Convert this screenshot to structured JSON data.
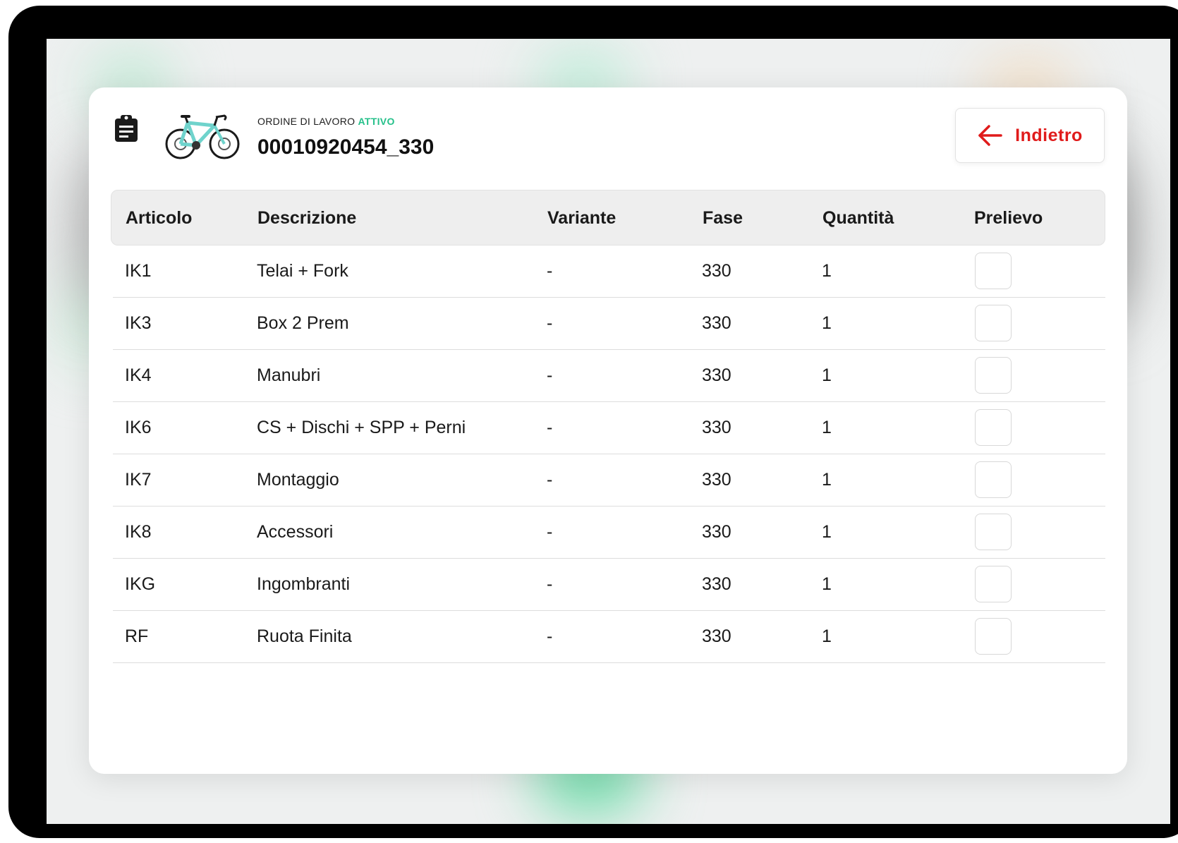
{
  "order": {
    "label": "ORDINE DI LAVORO",
    "status": "ATTIVO",
    "number": "00010920454_330"
  },
  "back_button": {
    "label": "Indietro"
  },
  "table": {
    "headers": [
      "Articolo",
      "Descrizione",
      "Variante",
      "Fase",
      "Quantità",
      "Prelievo"
    ],
    "rows": [
      {
        "articolo": "IK1",
        "descrizione": "Telai + Fork",
        "variante": "-",
        "fase": "330",
        "quantita": "1",
        "prelievo": false
      },
      {
        "articolo": "IK3",
        "descrizione": "Box 2 Prem",
        "variante": "-",
        "fase": "330",
        "quantita": "1",
        "prelievo": false
      },
      {
        "articolo": "IK4",
        "descrizione": "Manubri",
        "variante": "-",
        "fase": "330",
        "quantita": "1",
        "prelievo": false
      },
      {
        "articolo": "IK6",
        "descrizione": "CS + Dischi + SPP + Perni",
        "variante": "-",
        "fase": "330",
        "quantita": "1",
        "prelievo": false
      },
      {
        "articolo": "IK7",
        "descrizione": "Montaggio",
        "variante": "-",
        "fase": "330",
        "quantita": "1",
        "prelievo": false
      },
      {
        "articolo": "IK8",
        "descrizione": "Accessori",
        "variante": "-",
        "fase": "330",
        "quantita": "1",
        "prelievo": false
      },
      {
        "articolo": "IKG",
        "descrizione": "Ingombranti",
        "variante": "-",
        "fase": "330",
        "quantita": "1",
        "prelievo": false
      },
      {
        "articolo": "RF",
        "descrizione": "Ruota Finita",
        "variante": "-",
        "fase": "330",
        "quantita": "1",
        "prelievo": false
      }
    ]
  },
  "icons": {
    "clipboard": "clipboard-icon",
    "bike": "bike-icon",
    "back": "arrow-left-icon"
  },
  "colors": {
    "accent_red": "#e01b1b",
    "status_green": "#25c08a",
    "bike_frame": "#6fd3cc"
  }
}
